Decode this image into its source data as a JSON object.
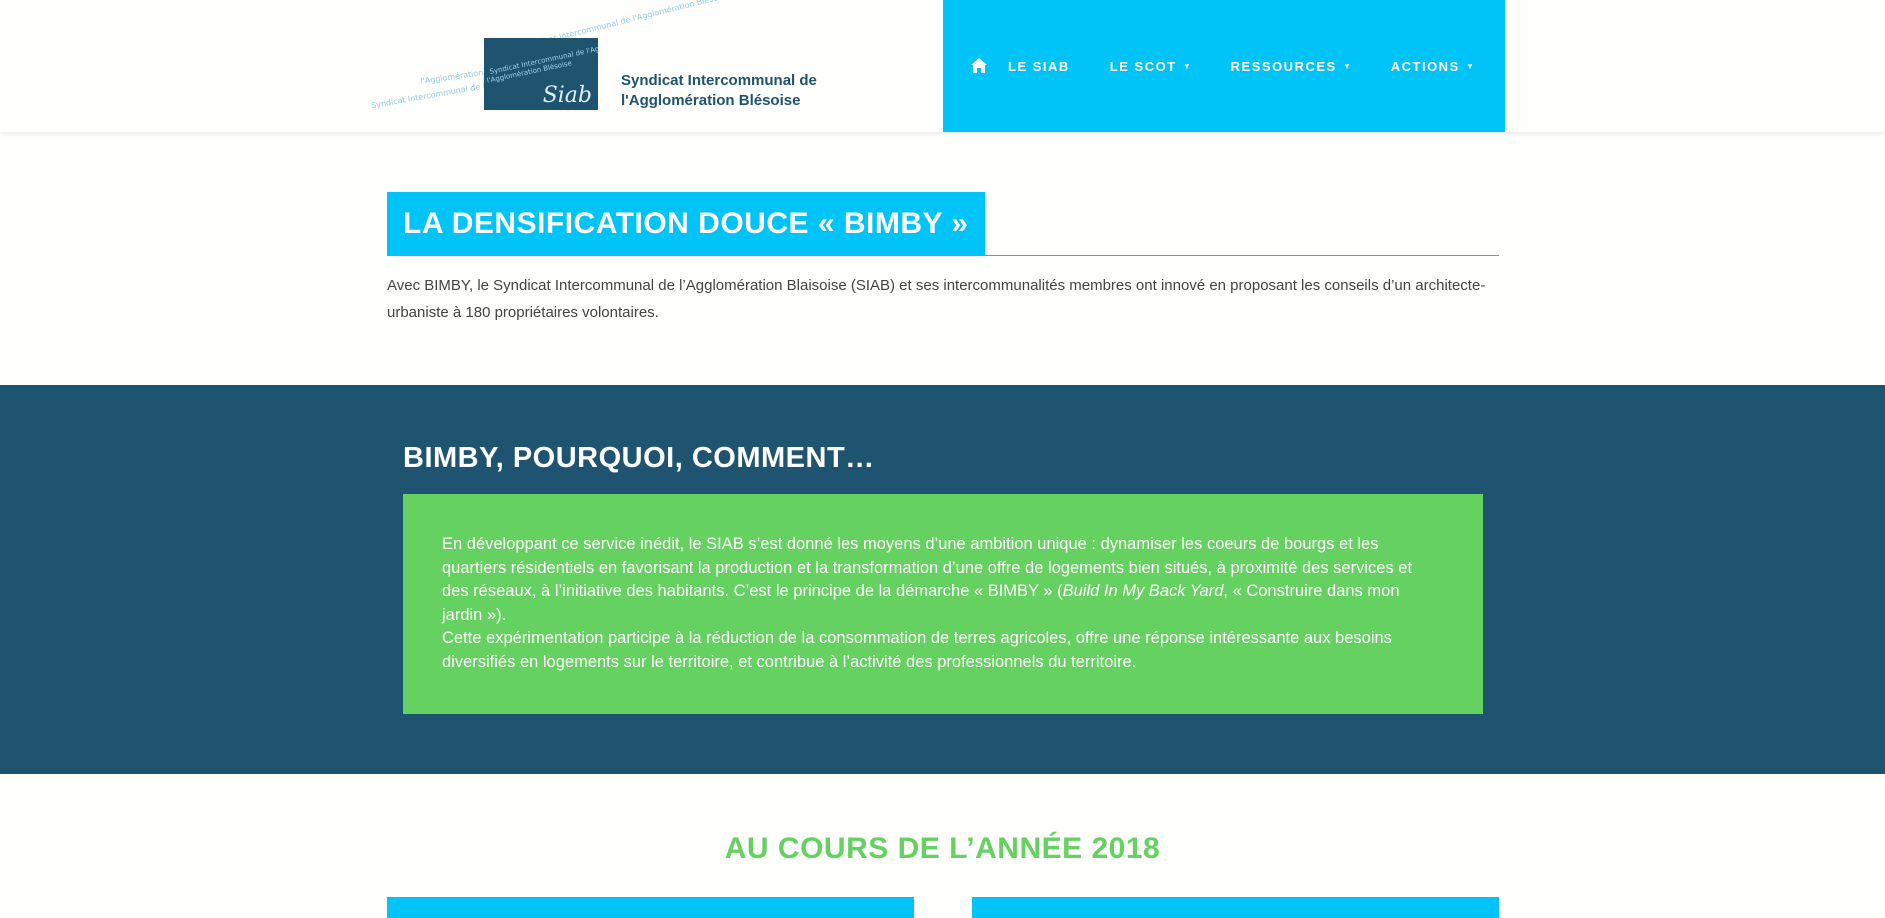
{
  "header": {
    "site_name_line1": "Syndicat Intercommunal de",
    "site_name_line2": "l'Agglomération Blésoise",
    "logo": {
      "script_text": "Siab",
      "scribble_lines": [
        "Syndicat Intercommunal de l'Agglomération",
        "Syndicat Intercommunal de l'Agglomération Blésoise",
        "l'Agglomération Blésoise"
      ]
    }
  },
  "nav": {
    "home_icon": "home-icon",
    "items": [
      {
        "label": "LE SIAB",
        "has_dropdown": false
      },
      {
        "label": "LE SCOT",
        "has_dropdown": true
      },
      {
        "label": "RESSOURCES",
        "has_dropdown": true
      },
      {
        "label": "ACTIONS",
        "has_dropdown": true
      }
    ],
    "caret": "▾"
  },
  "section1": {
    "title": "LA DENSIFICATION DOUCE « BIMBY »",
    "intro": "Avec BIMBY, le Syndicat Intercommunal de l’Agglomération Blaisoise (SIAB) et ses intercommunalités membres ont innové en proposant les conseils d’un architecte-urbaniste à 180 propriétaires volontaires."
  },
  "section2": {
    "title": "BIMBY, POURQUOI, COMMENT…",
    "para1_before": "En développant ce service inédit, le SIAB s’est donné les moyens d’une ambition unique : dynamiser les coeurs de bourgs et les quartiers résidentiels en favorisant la production et la transformation d’une offre de logements bien situés, à proximité des services et des réseaux, à l’initiative des habitants. C’est le principe de la démarche « BIMBY » (",
    "para1_italic": "Build In My Back Yard",
    "para1_after": ", « Construire dans mon jardin »).",
    "para2": "Cette expérimentation participe à la réduction de la consommation de terres agricoles, offre une réponse intéressante aux besoins diversifiés en logements sur le territoire, et contribue à l’activité des professionnels du territoire."
  },
  "section3": {
    "title": "AU COURS DE L’ANNÉE 2018"
  },
  "colors": {
    "accent_cyan": "#00c3f8",
    "dark_blue": "#1f5470",
    "green": "#65d160"
  }
}
